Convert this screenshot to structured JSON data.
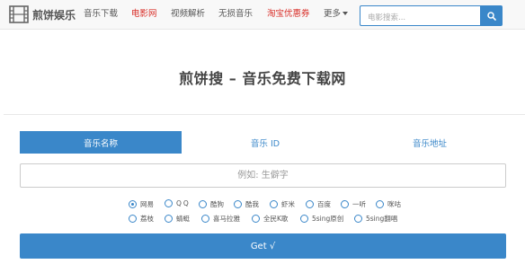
{
  "brand": {
    "name": "煎饼娱乐"
  },
  "nav": {
    "items": [
      {
        "label": "音乐下载",
        "highlight": false
      },
      {
        "label": "电影网",
        "highlight": true
      },
      {
        "label": "视频解析",
        "highlight": false
      },
      {
        "label": "无损音乐",
        "highlight": false
      },
      {
        "label": "淘宝优惠券",
        "highlight": true
      },
      {
        "label": "更多",
        "highlight": false,
        "dropdown": true
      }
    ]
  },
  "search": {
    "placeholder": "电影搜索...",
    "button_icon": "search-icon"
  },
  "page": {
    "title": "煎饼搜 – 音乐免费下载网"
  },
  "tabs": [
    {
      "label": "音乐名称",
      "active": true
    },
    {
      "label": "音乐 ID",
      "active": false
    },
    {
      "label": "音乐地址",
      "active": false
    }
  ],
  "main_input": {
    "placeholder": "例如: 生僻字",
    "value": ""
  },
  "sources": {
    "row1": [
      "网易",
      "QQ",
      "酷狗",
      "酷我",
      "虾米",
      "百度",
      "一听",
      "咪咕"
    ],
    "row2": [
      "荔枝",
      "蜻蜓",
      "喜马拉雅",
      "全民K歌",
      "5sing原创",
      "5sing翻唱"
    ],
    "selected": "网易"
  },
  "get_button": {
    "label": "Get √"
  },
  "colors": {
    "accent": "#3a87c9",
    "highlight": "#d9302a",
    "navbar_bg": "#f8f8f8"
  }
}
